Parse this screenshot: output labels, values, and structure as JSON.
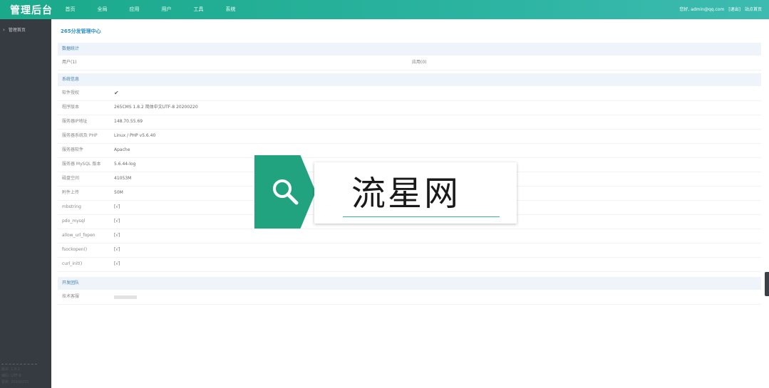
{
  "header": {
    "logo": "管理后台",
    "nav": [
      "首页",
      "全局",
      "应用",
      "用户",
      "工具",
      "系统"
    ],
    "user_greeting": "您好, admin@qq.com",
    "logout": "[退出]",
    "site_home": "站点首页"
  },
  "sidebar": {
    "items": [
      {
        "label": "管理首页"
      }
    ],
    "footer": [
      "版本: 1.8.2",
      "编码: UTF-8",
      "更新: 20200220"
    ]
  },
  "main": {
    "title": "265分发管理中心",
    "data_section": {
      "heading": "数据统计",
      "users": "用户(1)",
      "apps": "应用(0)"
    },
    "system_section": {
      "heading": "系统信息",
      "rows": [
        {
          "label": "软件授权",
          "value": "✔"
        },
        {
          "label": "程序版本",
          "value": "265CMS 1.8.2 简体中文UTF-8 20200220"
        },
        {
          "label": "服务器IP地址",
          "value": "148.70.55.69"
        },
        {
          "label": "服务器系统及 PHP",
          "value": "Linux / PHP v5.6.40"
        },
        {
          "label": "服务器软件",
          "value": "Apache"
        },
        {
          "label": "服务器 MySQL 版本",
          "value": "5.6.44-log"
        },
        {
          "label": "磁盘空间",
          "value": "41053M"
        },
        {
          "label": "附件上传",
          "value": "50M"
        },
        {
          "label": "mbstring",
          "value": "[√]"
        },
        {
          "label": "pdo_mysql",
          "value": "[√]"
        },
        {
          "label": "allow_url_fopen",
          "value": "[√]"
        },
        {
          "label": "fsockopen()",
          "value": "[√]"
        },
        {
          "label": "curl_init()",
          "value": "[√]"
        }
      ]
    },
    "dev_section": {
      "heading": "开发团队",
      "rows": [
        {
          "label": "技术客服"
        }
      ]
    }
  },
  "watermark": {
    "text": "流星网"
  },
  "colors": {
    "topbar": "#1aa98a",
    "sidebar": "#363a41",
    "accent_blue": "#2b8fc8",
    "ok_green": "#7ab800",
    "watermark_green": "#22a37f"
  }
}
